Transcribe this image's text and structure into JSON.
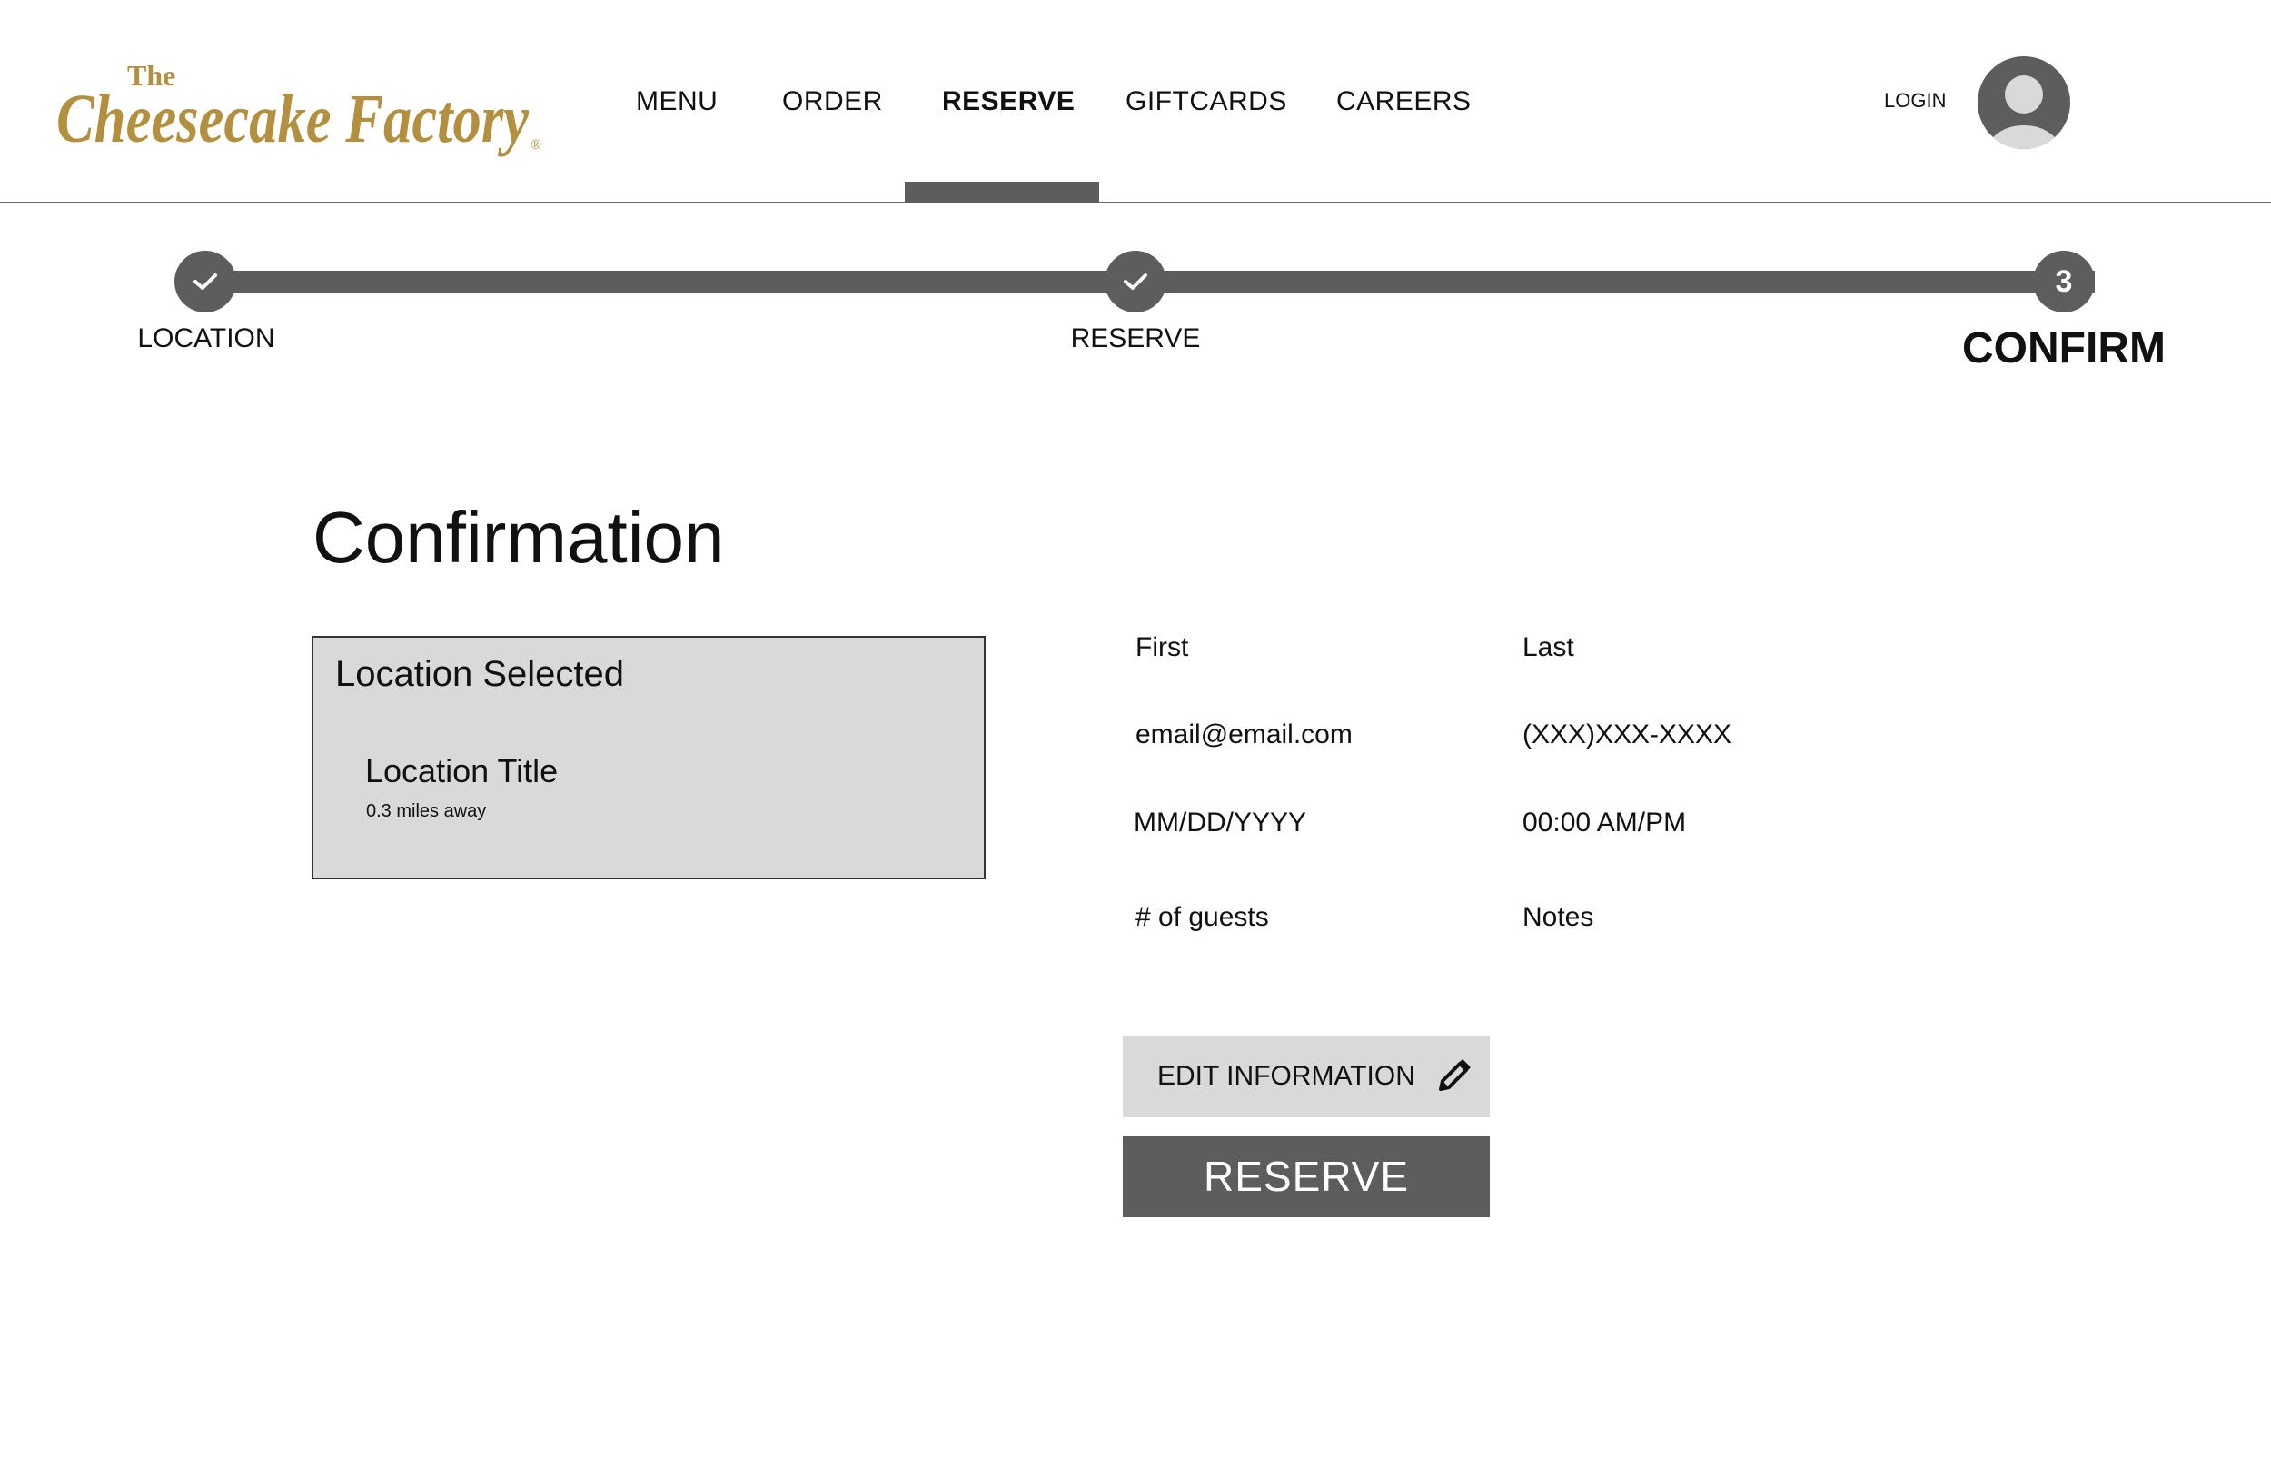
{
  "brand": {
    "name_small": "The",
    "name_main": "Cheesecake Factory",
    "registered": "®",
    "color": "#b3903f"
  },
  "nav": {
    "items": [
      {
        "label": "MENU"
      },
      {
        "label": "ORDER"
      },
      {
        "label": "RESERVE"
      },
      {
        "label": "GIFTCARDS"
      },
      {
        "label": "CAREERS"
      }
    ],
    "active": "RESERVE",
    "login": "LOGIN"
  },
  "stepper": {
    "steps": [
      {
        "label": "LOCATION",
        "status": "complete",
        "icon": "check-icon"
      },
      {
        "label": "RESERVE",
        "status": "complete",
        "icon": "check-icon"
      },
      {
        "label": "CONFIRM",
        "status": "current",
        "number": "3"
      }
    ]
  },
  "page": {
    "title": "Confirmation"
  },
  "location": {
    "heading": "Location Selected",
    "title": "Location Title",
    "distance": "0.3 miles away"
  },
  "details": {
    "first": "First",
    "last": "Last",
    "email": "email@email.com",
    "phone": "(XXX)XXX-XXXX",
    "date": "MM/DD/YYYY",
    "time": "00:00 AM/PM",
    "guests": "# of guests",
    "notes": "Notes"
  },
  "actions": {
    "edit_label": "EDIT INFORMATION",
    "edit_icon": "pencil-icon",
    "reserve_label": "RESERVE"
  },
  "colors": {
    "accent_dark": "#5d5d5d",
    "card_bg": "#d9d9d9",
    "logo_gold": "#b3903f"
  }
}
